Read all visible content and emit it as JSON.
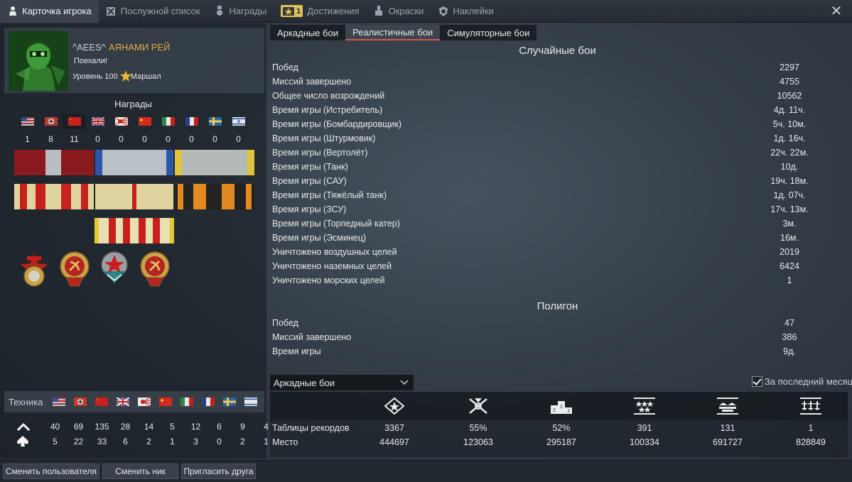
{
  "tabs": [
    {
      "label": "Карточка игрока",
      "icon": "player-card-icon",
      "active": true
    },
    {
      "label": "Послужной список",
      "icon": "service-record-icon"
    },
    {
      "label": "Награды",
      "icon": "awards-icon"
    },
    {
      "label": "Достижения",
      "icon": "achievements-icon",
      "badge": "1"
    },
    {
      "label": "Окраски",
      "icon": "camouflage-icon"
    },
    {
      "label": "Наклейки",
      "icon": "decals-icon"
    }
  ],
  "close_icon": "✕",
  "profile": {
    "tag": "^AEES^",
    "nick": "АЯНАМИ РЕЙ",
    "status": "Поехали!",
    "level": "Уровень 100",
    "rank": "Маршал"
  },
  "awards": {
    "title": "Награды",
    "countries": [
      "usa",
      "germany",
      "ussr",
      "britain",
      "japan",
      "china",
      "italy",
      "france",
      "sweden",
      "israel"
    ],
    "counts": [
      "1",
      "8",
      "11",
      "0",
      "0",
      "0",
      "0",
      "0",
      "0",
      "0"
    ]
  },
  "tech": {
    "label": "Техника",
    "countries": [
      "usa",
      "germany",
      "ussr",
      "britain",
      "japan",
      "china",
      "italy",
      "france",
      "sweden",
      "israel"
    ],
    "row1": [
      "40",
      "69",
      "135",
      "28",
      "14",
      "5",
      "12",
      "6",
      "9",
      "4"
    ],
    "row2": [
      "5",
      "22",
      "33",
      "6",
      "2",
      "1",
      "3",
      "0",
      "2",
      "1"
    ]
  },
  "buttons": {
    "switch_user": "Сменить пользователя",
    "change_nick": "Сменить ник",
    "invite": "Пригласить друга"
  },
  "modes": {
    "arcade": "Аркадные бои",
    "realistic": "Реалистичные бои",
    "simulator": "Симуляторные бои"
  },
  "random_battles": {
    "title": "Случайные бои",
    "rows": [
      {
        "label": "Побед",
        "value": "2297"
      },
      {
        "label": "Миссий завершено",
        "value": "4755"
      },
      {
        "label": "Общее число возрождений",
        "value": "10562"
      },
      {
        "label": "Время игры (Истребитель)",
        "value": "4д. 11ч."
      },
      {
        "label": "Время игры (Бомбардировщик)",
        "value": "5ч. 10м."
      },
      {
        "label": "Время игры (Штурмовик)",
        "value": "1д. 16ч."
      },
      {
        "label": "Время игры (Вертолёт)",
        "value": "22ч. 22м."
      },
      {
        "label": "Время игры (Танк)",
        "value": "10д."
      },
      {
        "label": "Время игры (САУ)",
        "value": "19ч. 18м."
      },
      {
        "label": "Время игры (Тяжёлый танк)",
        "value": "1д. 07ч."
      },
      {
        "label": "Время игры (ЗСУ)",
        "value": "17ч. 13м."
      },
      {
        "label": "Время игры (Торпедный катер)",
        "value": "3м."
      },
      {
        "label": "Время игры (Эсминец)",
        "value": "16м."
      },
      {
        "label": "Уничтожено воздушных целей",
        "value": "2019"
      },
      {
        "label": "Уничтожено наземных целей",
        "value": "6424"
      },
      {
        "label": "Уничтожено морских целей",
        "value": "1"
      }
    ]
  },
  "polygon": {
    "title": "Полигон",
    "rows": [
      {
        "label": "Побед",
        "value": "47"
      },
      {
        "label": "Миссий завершено",
        "value": "386"
      },
      {
        "label": "Время игры",
        "value": "9д."
      }
    ]
  },
  "leaderboard": {
    "mode": "Аркадные бои",
    "last_month": "За последний месяц",
    "icons": [
      "victories-icon",
      "winrate-icon",
      "podium-icon",
      "air-kills-icon",
      "ground-kills-icon",
      "naval-kills-icon"
    ],
    "rows": [
      {
        "label": "Таблицы рекордов",
        "values": [
          "3367",
          "55%",
          "52%",
          "391",
          "131",
          "1"
        ]
      },
      {
        "label": "Место",
        "values": [
          "444697",
          "123063",
          "295187",
          "100334",
          "691727",
          "828849"
        ]
      }
    ]
  }
}
